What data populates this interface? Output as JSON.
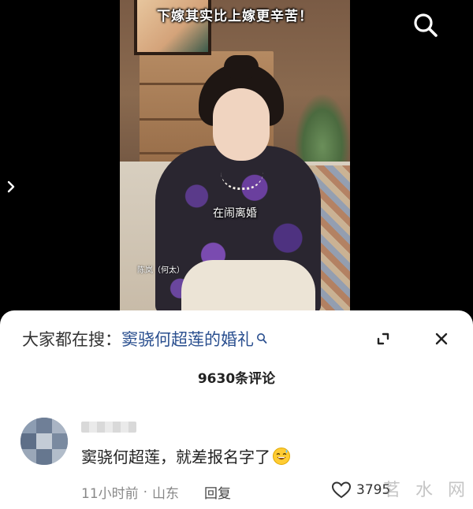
{
  "video": {
    "title_caption": "下嫁其实比上嫁更辛苦！",
    "subtitle": "在闹离婚",
    "speaker_tag": "陈岚（何太）"
  },
  "top_controls": {
    "search_icon": "search-icon",
    "expand_icon": "chevron-right-icon"
  },
  "search_bar": {
    "prefix": "大家都在搜：",
    "term": "窦骁何超莲的婚礼",
    "term_icon": "search-icon"
  },
  "sheet_controls": {
    "expand_icon": "expand-icon",
    "close_icon": "close-icon"
  },
  "comments": {
    "count_label": "9630条评论"
  },
  "comment": {
    "text": "窦骁何超莲，就差报名字了",
    "emoji_icon": "sweat-smile-emoji-icon",
    "time": "11小时前",
    "separator": "·",
    "location": "山东",
    "reply_label": "回复",
    "like_count": "3795",
    "like_icon": "heart-icon"
  },
  "watermark": {
    "text": "茗 水 网"
  },
  "colors": {
    "background": "#000000",
    "sheet": "#ffffff",
    "search_term": "#2a4f8f",
    "meta": "#888888"
  }
}
